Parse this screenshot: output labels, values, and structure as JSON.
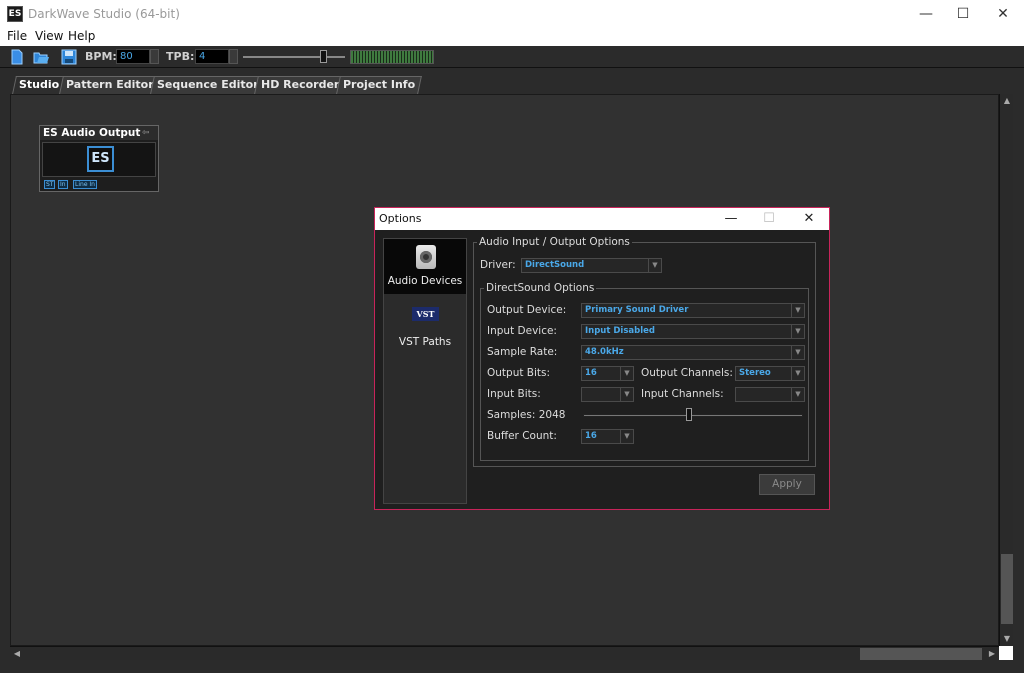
{
  "window": {
    "title": "DarkWave Studio (64-bit)",
    "icon_text": "ES",
    "minimize": "—",
    "maximize": "☐",
    "close": "✕"
  },
  "menu": {
    "items": [
      "File",
      "View",
      "Help"
    ]
  },
  "toolbar": {
    "bpm_label": "BPM:",
    "bpm_value": "80",
    "tpb_label": "TPB:",
    "tpb_value": "4",
    "master_volume": 0.78
  },
  "tabs": [
    "Studio",
    "Pattern Editor",
    "Sequence Editor",
    "HD Recorder",
    "Project Info"
  ],
  "module": {
    "title": "ES Audio Output",
    "logo": "ES",
    "ports": [
      "ST",
      "In",
      "Line In"
    ]
  },
  "dialog": {
    "title": "Options",
    "nav": [
      {
        "label": "Audio Devices"
      },
      {
        "label": "VST Paths",
        "logo": "VST"
      }
    ],
    "io_group": "Audio Input / Output Options",
    "driver_label": "Driver:",
    "driver_value": "DirectSound",
    "ds_group": "DirectSound Options",
    "output_device_label": "Output Device:",
    "output_device_value": "Primary Sound Driver",
    "input_device_label": "Input Device:",
    "input_device_value": "Input Disabled",
    "sample_rate_label": "Sample Rate:",
    "sample_rate_value": "48.0kHz",
    "output_bits_label": "Output Bits:",
    "output_bits_value": "16",
    "output_channels_label": "Output Channels:",
    "output_channels_value": "Stereo",
    "input_bits_label": "Input Bits:",
    "input_bits_value": "",
    "input_channels_label": "Input Channels:",
    "input_channels_value": "",
    "samples_label": "Samples: 2048",
    "samples_position": 0.48,
    "buffer_count_label": "Buffer Count:",
    "buffer_count_value": "16",
    "apply_label": "Apply"
  }
}
